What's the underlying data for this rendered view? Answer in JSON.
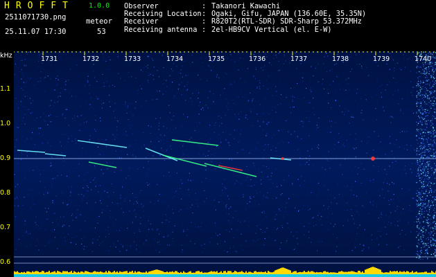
{
  "header": {
    "app_name": "HROFFT",
    "version": "1.0.0",
    "file_name": "2511071730.png",
    "date_time": "25.11.07 17:30",
    "meteor_label": "meteor",
    "meteor_count": "53"
  },
  "info": {
    "rows": [
      {
        "key": "Observer",
        "sep": ":",
        "value": "Takanori Kawachi"
      },
      {
        "key": "Receiving Location",
        "sep": ":",
        "value": "Ogaki, Gifu, JAPAN (136.60E, 35.35N)"
      },
      {
        "key": "Receiver",
        "sep": ":",
        "value": "R820T2(RTL-SDR) SDR-Sharp 53.372MHz"
      },
      {
        "key": "Receiving antenna",
        "sep": ":",
        "value": "2el-HB9CV Vertical (el. E-W)"
      }
    ]
  },
  "spectrogram": {
    "y_unit": "kHz",
    "y_ticks": [
      "1.1",
      "1.0",
      "0.9",
      "0.8",
      "0.7",
      "0.6"
    ],
    "x_ticks": [
      "1731",
      "1732",
      "1733",
      "1734",
      "1735",
      "1736",
      "1737",
      "1738",
      "1739",
      "1740"
    ],
    "colors": {
      "background": "#000000",
      "noise_dark": "#000a30",
      "noise_mid": "#0a1f78",
      "noise_bright": "#3a6cff",
      "signal_green": "#39ff8a",
      "signal_cyan": "#6ff3ff",
      "signal_red": "#ff3b3b",
      "bottom_bar_yellow": "#ffd900",
      "bottom_bar_cyan": "#00c8ff"
    }
  }
}
